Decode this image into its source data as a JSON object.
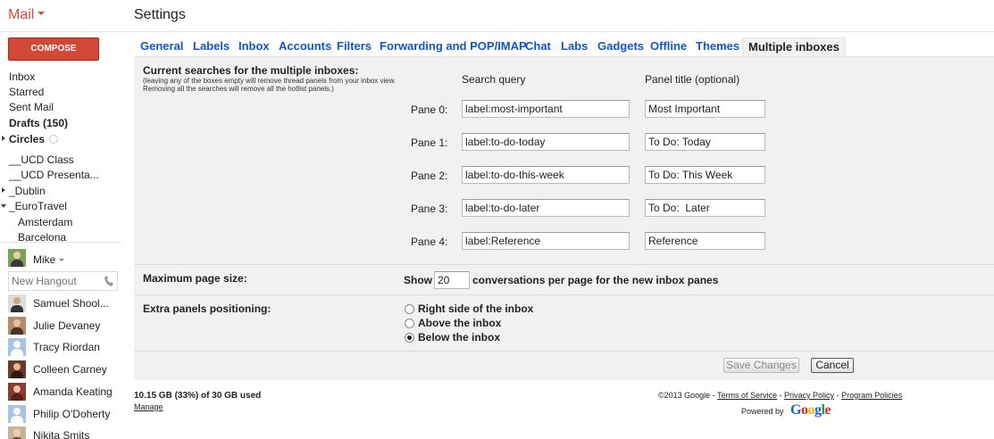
{
  "header": {
    "app_menu": "Mail",
    "page_title": "Settings"
  },
  "compose_label": "COMPOSE",
  "nav": {
    "inbox": "Inbox",
    "starred": "Starred",
    "sent": "Sent Mail",
    "drafts": "Drafts (150)",
    "circles": "Circles",
    "ucd_class": "__UCD Class",
    "ucd_presenta": "__UCD Presenta...",
    "dublin": "_Dublin",
    "eurotravel": "_EuroTravel",
    "amsterdam": "Amsterdam",
    "barcelona": "Barcelona"
  },
  "hangouts": {
    "user": "Mike",
    "input_placeholder": "New Hangout",
    "contacts": [
      "Samuel Shool...",
      "Julie Devaney",
      "Tracy Riordan",
      "Colleen Carney",
      "Amanda Keating",
      "Philip O'Doherty",
      "Nikita Smits"
    ]
  },
  "tabs": [
    "General",
    "Labels",
    "Inbox",
    "Accounts",
    "Filters",
    "Forwarding and POP/IMAP",
    "Chat",
    "Labs",
    "Gadgets",
    "Offline",
    "Themes",
    "Multiple inboxes"
  ],
  "active_tab": "Multiple inboxes",
  "multiple_inboxes": {
    "title": "Current searches for the multiple inboxes:",
    "note": "(leaving any of the boxes empty will remove thread panels from your inbox view. Removing all the searches will remove all the hotlist panels.)",
    "col_query": "Search query",
    "col_title": "Panel title (optional)",
    "panes": [
      {
        "label": "Pane 0:",
        "query": "label:most-important",
        "title": "Most Important"
      },
      {
        "label": "Pane 1:",
        "query": "label:to-do-today",
        "title": "To Do: Today"
      },
      {
        "label": "Pane 2:",
        "query": "label:to-do-this-week",
        "title": "To Do: This Week"
      },
      {
        "label": "Pane 3:",
        "query": "label:to-do-later",
        "title": "To Do:  Later"
      },
      {
        "label": "Pane 4:",
        "query": "label:Reference",
        "title": "Reference"
      }
    ]
  },
  "page_size": {
    "title": "Maximum page size:",
    "show": "Show",
    "value": "20",
    "suffix": "conversations per page for the new inbox panes"
  },
  "positioning": {
    "title": "Extra panels positioning:",
    "options": [
      "Right side of the inbox",
      "Above the inbox",
      "Below the inbox"
    ],
    "selected": "Below the inbox"
  },
  "buttons": {
    "save": "Save Changes",
    "cancel": "Cancel"
  },
  "footer": {
    "storage": "10.15 GB (33%) of 30 GB used",
    "manage": "Manage",
    "copyright": "©2013 Google - ",
    "terms": "Terms of Service",
    "privacy": "Privacy Policy",
    "programs": "Program Policies",
    "sep": " - ",
    "powered_by": "Powered by",
    "google": "Google"
  },
  "colors": {
    "compose": "#d14836",
    "link": "#1155cc",
    "brand_red": "#dd4b39"
  }
}
